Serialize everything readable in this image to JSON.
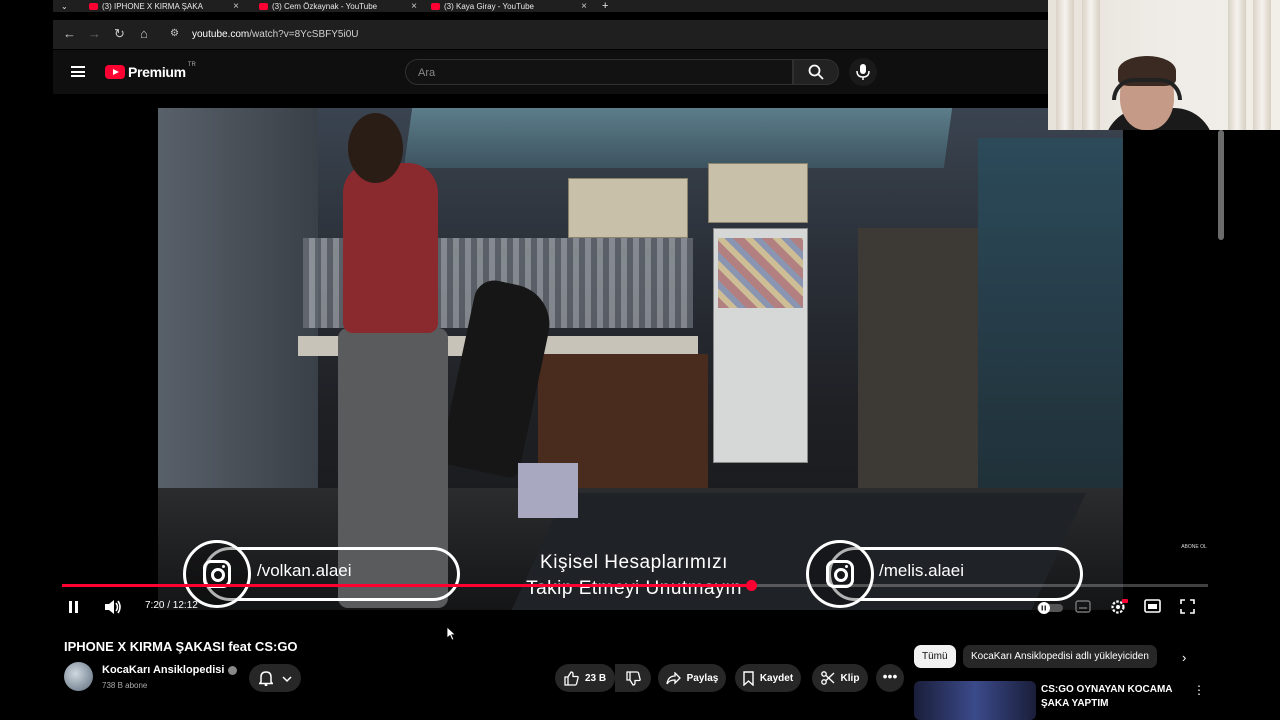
{
  "browser": {
    "tabs": [
      {
        "label": "(3) IPHONE X KIRMA ŞAKA"
      },
      {
        "label": "(3) Cem Özkaynak - YouTube"
      },
      {
        "label": "(3) Kaya Giray - YouTube"
      }
    ],
    "new_tab": "+",
    "url_domain": "youtube.com",
    "url_path": "/watch?v=8YcSBFY5i0U"
  },
  "youtube": {
    "logo_text": "Premium",
    "region": "TR",
    "search_placeholder": "Ara"
  },
  "video_overlay": {
    "handle_left": "/volkan.alaei",
    "handle_right": "/melis.alaei",
    "center_line1": "Kişisel Hesaplarımızı",
    "center_line2": "Takip Etmeyi Unutmayın",
    "corner_logo": "ABONE OL"
  },
  "player": {
    "time": "7:20 / 12:12",
    "progress_fraction": 0.601,
    "accent_color": "#ff0033"
  },
  "video_info": {
    "title": "IPHONE X KIRMA ŞAKASI feat CS:GO",
    "channel": "KocaKarı Ansiklopedisi",
    "subscribers": "738 B abone",
    "likes": "23 B",
    "share": "Paylaş",
    "save": "Kaydet",
    "clip": "Klip"
  },
  "sidebar": {
    "chip_all": "Tümü",
    "chip_uploader": "KocaKarı Ansiklopedisi adlı yükleyiciden",
    "rec_title": "CS:GO OYNAYAN KOCAMA ŞAKA YAPTIM"
  }
}
